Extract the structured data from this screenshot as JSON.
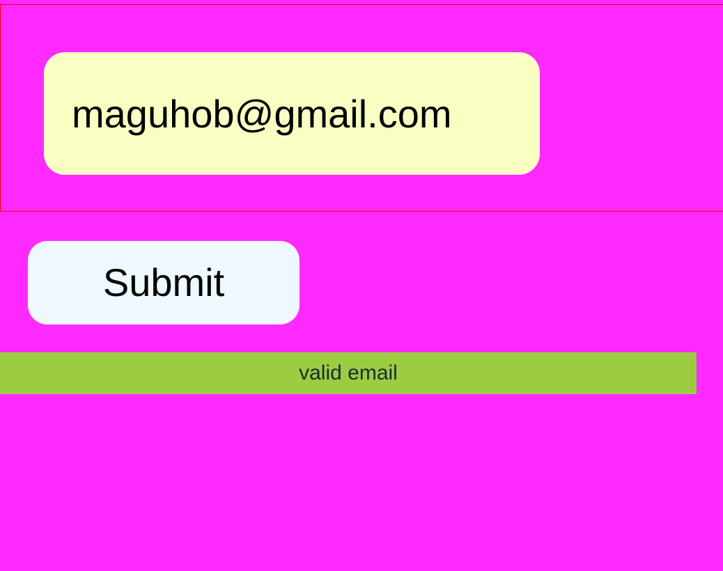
{
  "colors": {
    "page_background": "#ff2aff",
    "email_panel_border": "#ff0000",
    "email_field_background": "#f9ffc3",
    "submit_button_background": "#eff7ff",
    "status_background": "#9ccc42",
    "status_text": "#1f2a2f"
  },
  "form": {
    "email": {
      "value": "maguhob@gmail.com"
    },
    "submit_label": "Submit"
  },
  "status": {
    "message": "valid email"
  }
}
